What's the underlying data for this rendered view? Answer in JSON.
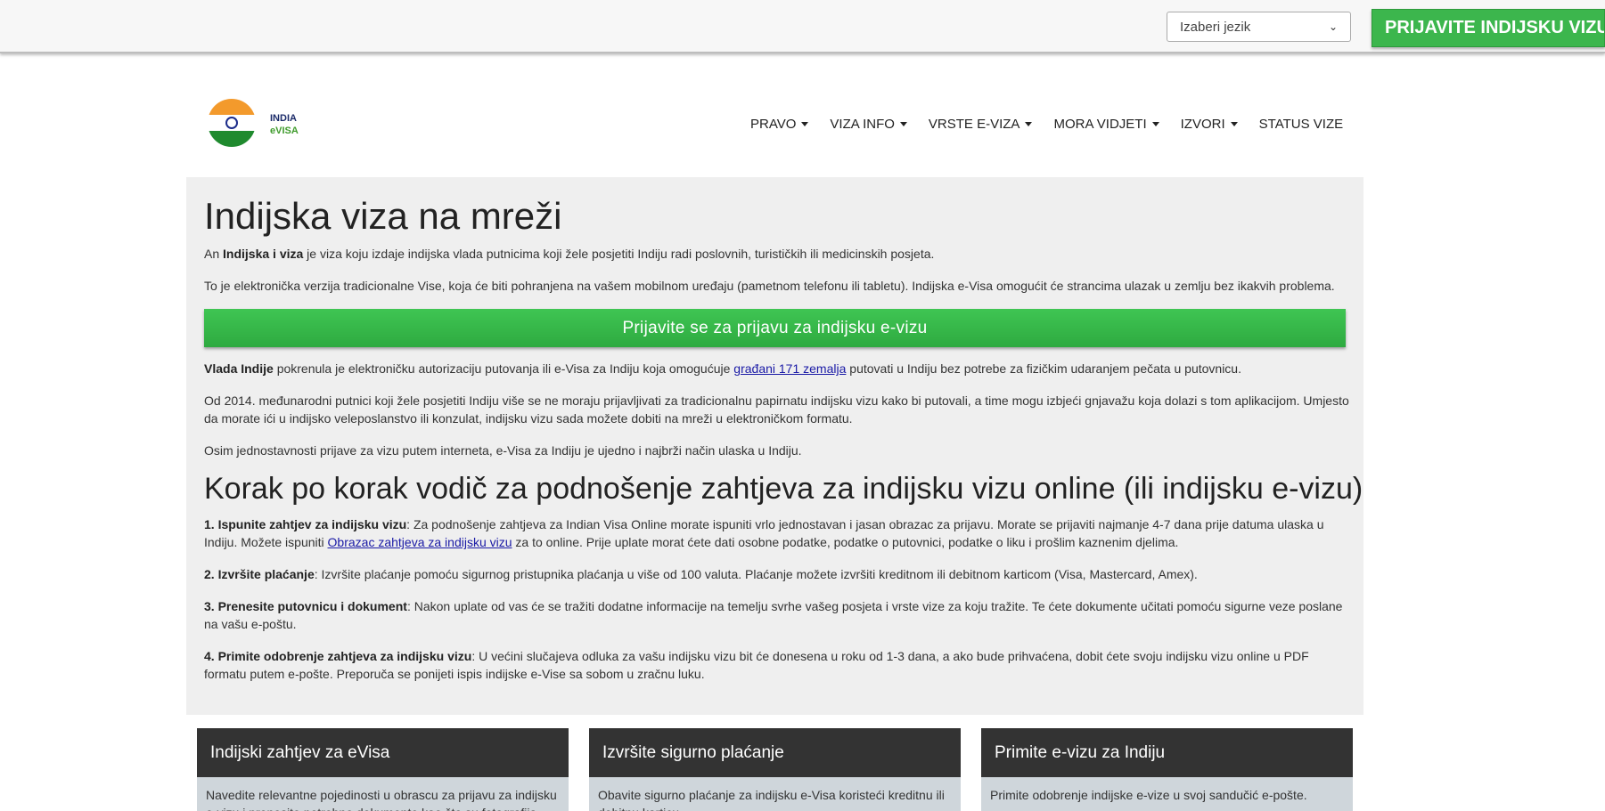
{
  "topbar": {
    "language_select": "Izaberi jezik",
    "apply_button": "PRIJAVITE INDIJSKU VIZU"
  },
  "logo": {
    "line1": "INDIA",
    "line2": "eVISA",
    "colors": {
      "saffron": "#f39a2c",
      "green": "#1f8a2e",
      "navy": "#1c2c8a"
    }
  },
  "nav": [
    {
      "label": "PRAVO",
      "dropdown": true
    },
    {
      "label": "VIZA INFO",
      "dropdown": true
    },
    {
      "label": "VRSTE E-VIZA",
      "dropdown": true
    },
    {
      "label": "MORA VIDJETI",
      "dropdown": true
    },
    {
      "label": "IZVORI",
      "dropdown": true
    },
    {
      "label": "STATUS VIZE",
      "dropdown": false
    }
  ],
  "main": {
    "title": "Indijska viza na mreži",
    "intro": {
      "pre": "An ",
      "bold": "Indijska i viza",
      "post": " je viza koju izdaje indijska vlada putnicima koji žele posjetiti Indiju radi poslovnih, turističkih ili medicinskih posjeta."
    },
    "para2": "To je elektronička verzija tradicionalne Vise, koja će biti pohranjena na vašem mobilnom uređaju (pametnom telefonu ili tabletu). Indijska e-Visa omogućit će strancima ulazak u zemlju bez ikakvih problema.",
    "apply_button": "Prijavite se za prijavu za indijsku e-vizu",
    "para3": {
      "bold": "Vlada Indije",
      "pre": " pokrenula je elektroničku autorizaciju putovanja ili e-Visa za Indiju koja omogućuje ",
      "link": "građani 171 zemalja",
      "post": " putovati u Indiju bez potrebe za fizičkim udaranjem pečata u putovnicu."
    },
    "para4": "Od 2014. međunarodni putnici koji žele posjetiti Indiju više se ne moraju prijavljivati za tradicionalnu papirnatu indijsku vizu kako bi putovali, a time mogu izbjeći gnjavažu koja dolazi s tom aplikacijom. Umjesto da morate ići u indijsko veleposlanstvo ili konzulat, indijsku vizu sada možete dobiti na mreži u elektroničkom formatu.",
    "para5": "Osim jednostavnosti prijave za vizu putem interneta, e-Visa za Indiju je ujedno i najbrži način ulaska u Indiju.",
    "guide_title": "Korak po korak vodič za podnošenje zahtjeva za indijsku vizu online (ili indijsku e-vizu)",
    "steps": [
      {
        "bold": "1. Ispunite zahtjev za indijsku vizu",
        "pre": ": Za podnošenje zahtjeva za Indian Visa Online morate ispuniti vrlo jednostavan i jasan obrazac za prijavu. Morate se prijaviti najmanje 4-7 dana prije datuma ulaska u Indiju. Možete ispuniti ",
        "link": "Obrazac zahtjeva za indijsku vizu",
        "post": " za to online. Prije uplate morat ćete dati osobne podatke, podatke o putovnici, podatke o liku i prošlim kaznenim djelima."
      },
      {
        "bold": "2. Izvršite plaćanje",
        "text": ": Izvršite plaćanje pomoću sigurnog pristupnika plaćanja u više od 100 valuta. Plaćanje možete izvršiti kreditnom ili debitnom karticom (Visa, Mastercard, Amex)."
      },
      {
        "bold": "3. Prenesite putovnicu i dokument",
        "text": ": Nakon uplate od vas će se tražiti dodatne informacije na temelju svrhe vašeg posjeta i vrste vize za koju tražite. Te ćete dokumente učitati pomoću sigurne veze poslane na vašu e-poštu."
      },
      {
        "bold": "4. Primite odobrenje zahtjeva za indijsku vizu",
        "text": ": U većini slučajeva odluka za vašu indijsku vizu bit će donesena u roku od 1-3 dana, a ako bude prihvaćena, dobit ćete svoju indijsku vizu online u PDF formatu putem e-pošte. Preporuča se ponijeti ispis indijske e-Vise sa sobom u zračnu luku."
      }
    ]
  },
  "cards": [
    {
      "title": "Indijski zahtjev za eVisa",
      "body": "Navedite relevantne pojedinosti u obrascu za prijavu za indijsku e-vizu i prenesite potrebne dokumente kao što su fotografija"
    },
    {
      "title": "Izvršite sigurno plaćanje",
      "body": "Obavite sigurno plaćanje za indijsku e-Visa koristeći kreditnu ili debitnu karticu."
    },
    {
      "title": "Primite e-vizu za Indiju",
      "body": "Primite odobrenje indijske e-vize u svoj sandučić e-pošte."
    }
  ]
}
